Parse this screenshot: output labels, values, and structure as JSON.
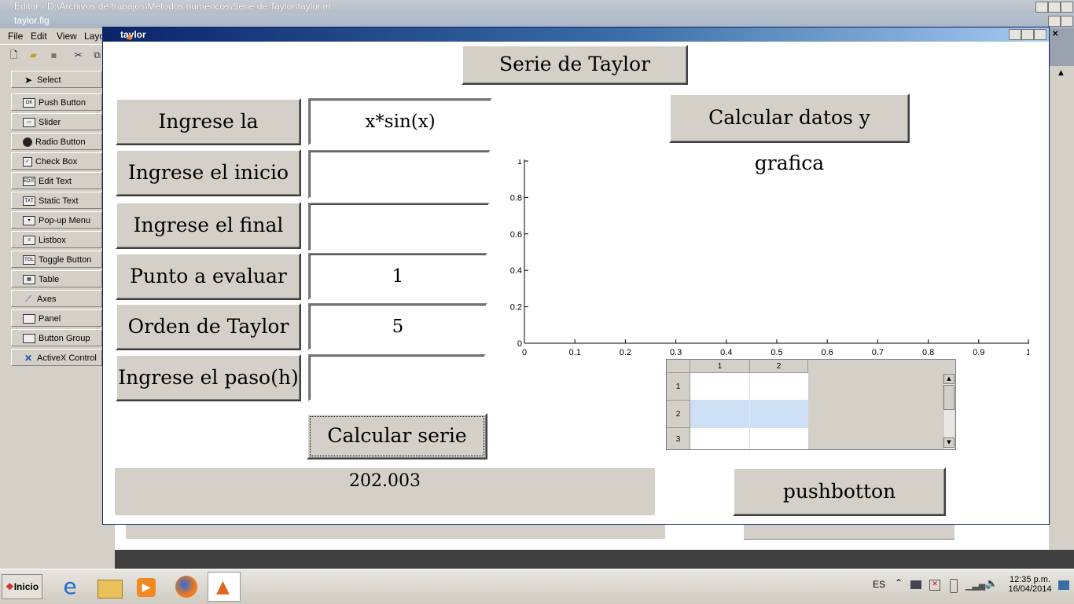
{
  "editor": {
    "title": "Editor - D:\\Archivos de trabajos\\Metodos numericos\\Serie de Taylor\\taylor.m"
  },
  "guide": {
    "title": "taylor.fig",
    "menu": [
      "File",
      "Edit",
      "View",
      "Layo"
    ],
    "palette": [
      {
        "label": "Select",
        "icon": "cursor-arrow-icon"
      },
      {
        "label": "Push Button",
        "icon": "push-button-icon"
      },
      {
        "label": "Slider",
        "icon": "slider-icon"
      },
      {
        "label": "Radio Button",
        "icon": "radio-button-icon"
      },
      {
        "label": "Check Box",
        "icon": "check-box-icon"
      },
      {
        "label": "Edit Text",
        "icon": "edit-text-icon"
      },
      {
        "label": "Static Text",
        "icon": "static-text-icon"
      },
      {
        "label": "Pop-up Menu",
        "icon": "popup-menu-icon"
      },
      {
        "label": "Listbox",
        "icon": "listbox-icon"
      },
      {
        "label": "Toggle Button",
        "icon": "toggle-button-icon"
      },
      {
        "label": "Table",
        "icon": "table-icon"
      },
      {
        "label": "Axes",
        "icon": "axes-icon"
      },
      {
        "label": "Panel",
        "icon": "panel-icon"
      },
      {
        "label": "Button Group",
        "icon": "button-group-icon"
      },
      {
        "label": "ActiveX Control",
        "icon": "activex-icon"
      }
    ]
  },
  "figure": {
    "title": "taylor",
    "header_button": "Serie de Taylor",
    "labels": {
      "ecuacion": "Ingrese la ecuación",
      "inicio": "Ingrese el inicio",
      "final": "Ingrese el final",
      "punto": "Punto a evaluar",
      "orden": "Orden de Taylor",
      "paso": "Ingrese el paso(h)"
    },
    "inputs": {
      "ecuacion": "x*sin(x)",
      "inicio": "",
      "final": "",
      "punto": "1",
      "orden": "5",
      "paso": ""
    },
    "calc_serie_button": "Calcular serie",
    "calc_datos_button": "Calcular datos y grafica",
    "result": "202.003",
    "pushbotton": "pushbotton",
    "table": {
      "columns": [
        "1",
        "2"
      ],
      "rows": [
        "1",
        "2",
        "3"
      ]
    }
  },
  "chart_data": {
    "type": "line",
    "title": "",
    "xlabel": "",
    "ylabel": "",
    "xlim": [
      0,
      1
    ],
    "ylim": [
      0,
      1
    ],
    "xticks": [
      "0",
      "0.1",
      "0.2",
      "0.3",
      "0.4",
      "0.5",
      "0.6",
      "0.7",
      "0.8",
      "0.9",
      "1"
    ],
    "yticks": [
      "0",
      "0.2",
      "0.4",
      "0.6",
      "0.8",
      "1"
    ],
    "series": []
  },
  "taskbar": {
    "start_label": "Inicio",
    "language": "ES",
    "time": "12:35 p.m.",
    "date": "16/04/2014"
  }
}
